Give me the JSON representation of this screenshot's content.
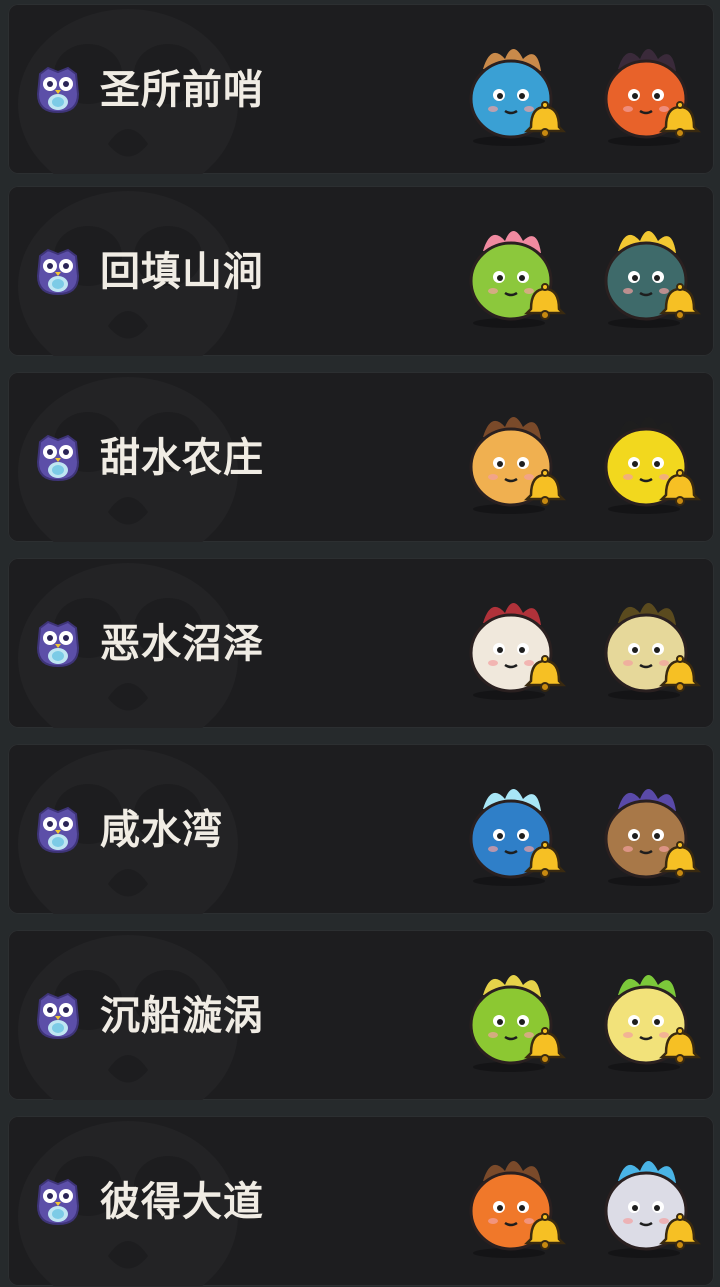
{
  "locations": [
    {
      "name": "圣所前哨",
      "pets": [
        {
          "icon": "blue-boar-pet-icon",
          "body": "#3aa0d4",
          "accent": "#c98a4a"
        },
        {
          "icon": "orange-flame-bird-pet-icon",
          "body": "#e8622a",
          "accent": "#3a2a3a"
        }
      ]
    },
    {
      "name": "回填山涧",
      "pets": [
        {
          "icon": "green-sprout-pet-icon",
          "body": "#8cc83c",
          "accent": "#f08aa0"
        },
        {
          "icon": "teal-robot-pet-icon",
          "body": "#3e6a6a",
          "accent": "#f2c832"
        }
      ]
    },
    {
      "name": "甜水农庄",
      "pets": [
        {
          "icon": "orange-cat-pet-icon",
          "body": "#f0b050",
          "accent": "#7a4a2a"
        },
        {
          "icon": "yellow-duck-pet-icon",
          "body": "#f2d81e",
          "accent": "#1e1e1e"
        }
      ]
    },
    {
      "name": "恶水沼泽",
      "pets": [
        {
          "icon": "rabbit-hood-pet-icon",
          "body": "#f0e8dc",
          "accent": "#b0323a"
        },
        {
          "icon": "swamp-bug-pet-icon",
          "body": "#e6d89a",
          "accent": "#5a4a1e"
        }
      ]
    },
    {
      "name": "咸水湾",
      "pets": [
        {
          "icon": "crystal-whale-pet-icon",
          "body": "#2f7fc8",
          "accent": "#a8e6f6"
        },
        {
          "icon": "brown-fish-pet-icon",
          "body": "#a87848",
          "accent": "#5a4aa8"
        }
      ]
    },
    {
      "name": "沉船漩涡",
      "pets": [
        {
          "icon": "green-slime-pet-icon",
          "body": "#8cc832",
          "accent": "#e6d24a"
        },
        {
          "icon": "clover-seed-pet-icon",
          "body": "#f2e27a",
          "accent": "#7cc83a"
        }
      ]
    },
    {
      "name": "彼得大道",
      "pets": [
        {
          "icon": "fire-horn-pet-icon",
          "body": "#f0782a",
          "accent": "#7a4a2a"
        },
        {
          "icon": "white-ghost-pet-icon",
          "body": "#dcdce6",
          "accent": "#4ab4e6"
        }
      ]
    }
  ],
  "colors": {
    "card_bg": "#1d1d1f",
    "page_bg": "#262a2c",
    "label": "#f0ece4",
    "owl": "#5c4fa8",
    "bell": "#f6c024"
  }
}
